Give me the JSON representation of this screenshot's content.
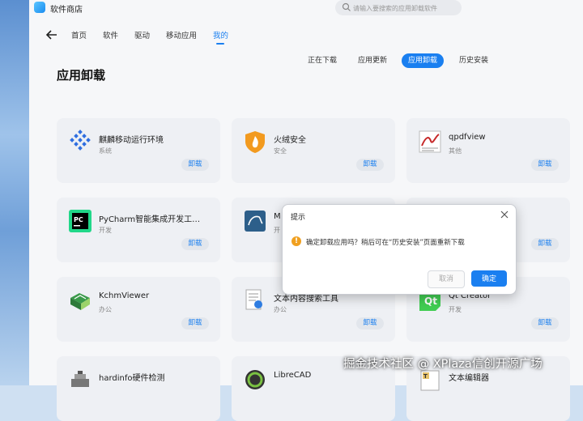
{
  "app": {
    "title": "软件商店"
  },
  "search": {
    "placeholder": "请输入要搜索的应用卸载软件"
  },
  "nav": [
    "首页",
    "软件",
    "驱动",
    "移动应用",
    "我的"
  ],
  "nav_active": "我的",
  "subtabs": [
    "正在下载",
    "应用更新",
    "应用卸载",
    "历史安装"
  ],
  "subtab_active": "应用卸载",
  "page_title": "应用卸载",
  "uninstall_label": "卸载",
  "apps": [
    {
      "name": "麒麟移动运行环境",
      "category": "系统",
      "icon": "kylin-mobile-icon"
    },
    {
      "name": "火绒安全",
      "category": "安全",
      "icon": "huorong-icon"
    },
    {
      "name": "qpdfview",
      "category": "其他",
      "icon": "qpdfview-icon"
    },
    {
      "name": "PyCharm智能集成开发工…",
      "category": "开发",
      "icon": "pycharm-icon"
    },
    {
      "name": "M",
      "category": "开",
      "icon": "mysql-workbench-icon"
    },
    {
      "name": "",
      "category": "",
      "icon": "hidden-app-icon"
    },
    {
      "name": "KchmViewer",
      "category": "办公",
      "icon": "kchmviewer-icon"
    },
    {
      "name": "文本内容搜索工具",
      "category": "办公",
      "icon": "text-search-icon"
    },
    {
      "name": "Qt Creator",
      "category": "开发",
      "icon": "qt-creator-icon"
    },
    {
      "name": "hardinfo硬件检测",
      "category": "",
      "icon": "hardinfo-icon"
    },
    {
      "name": "LibreCAD",
      "category": "",
      "icon": "librecad-icon"
    },
    {
      "name": "文本编辑器",
      "category": "",
      "icon": "text-editor-icon"
    }
  ],
  "dialog": {
    "title": "提示",
    "message": "确定卸载应用吗？稍后可在“历史安装”页面重新下载",
    "cancel": "取消",
    "ok": "确定"
  },
  "watermark": "掘金技术社区 @ XPlaza信创开源广场",
  "colors": {
    "accent": "#1a7ff0",
    "warning": "#f0a020",
    "card_bg": "#eef0f4"
  }
}
